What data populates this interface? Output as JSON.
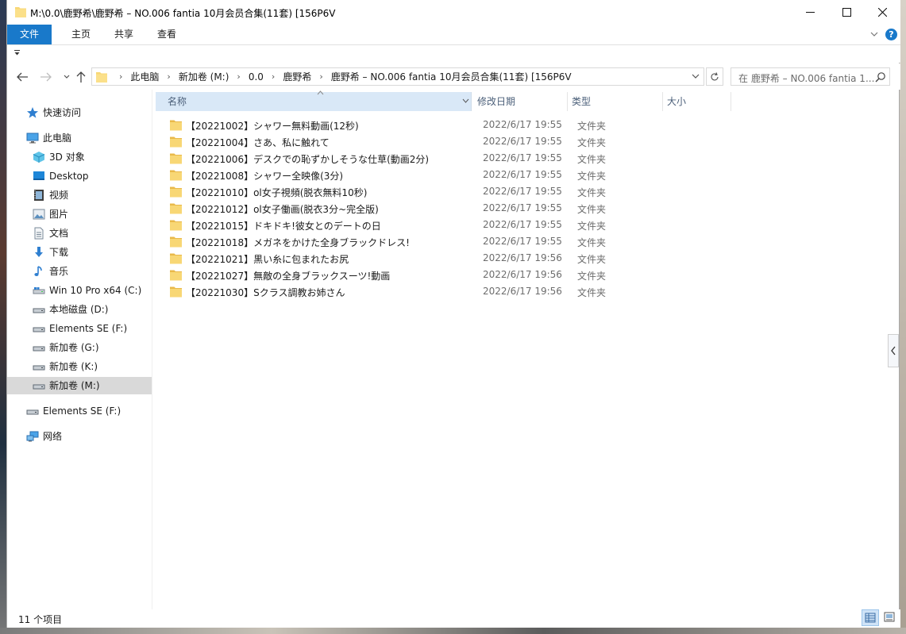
{
  "window": {
    "title": "M:\\0.0\\鹿野希\\鹿野希 – NO.006 fantia 10月会员合集(11套) [156P6V",
    "controls": {
      "minimize": "—",
      "maximize": "☐",
      "close": "✕"
    }
  },
  "ribbon": {
    "tabs": [
      "文件",
      "主页",
      "共享",
      "查看"
    ],
    "help": "?"
  },
  "address": {
    "crumbs": [
      "此电脑",
      "新加卷 (M:)",
      "0.0",
      "鹿野希",
      "鹿野希 – NO.006 fantia 10月会员合集(11套) [156P6V"
    ],
    "search_placeholder": "在 鹿野希 – NO.006 fantia 1..."
  },
  "nav": {
    "quick_access": "快速访问",
    "this_pc": "此电脑",
    "items": [
      {
        "label": "3D 对象",
        "icon": "3d-objects-icon"
      },
      {
        "label": "Desktop",
        "icon": "desktop-icon"
      },
      {
        "label": "视频",
        "icon": "video-icon"
      },
      {
        "label": "图片",
        "icon": "pictures-icon"
      },
      {
        "label": "文档",
        "icon": "documents-icon"
      },
      {
        "label": "下载",
        "icon": "download-icon"
      },
      {
        "label": "音乐",
        "icon": "music-icon"
      },
      {
        "label": "Win 10 Pro x64 (C:)",
        "icon": "system-drive-icon"
      },
      {
        "label": "本地磁盘 (D:)",
        "icon": "drive-icon"
      },
      {
        "label": "Elements SE (F:)",
        "icon": "drive-icon"
      },
      {
        "label": "新加卷 (G:)",
        "icon": "drive-icon"
      },
      {
        "label": "新加卷 (K:)",
        "icon": "drive-icon"
      },
      {
        "label": "新加卷 (M:)",
        "icon": "drive-icon",
        "selected": true
      }
    ],
    "external": "Elements SE (F:)",
    "network": "网络"
  },
  "columns": {
    "name": "名称",
    "date": "修改日期",
    "type": "类型",
    "size": "大小"
  },
  "files": [
    {
      "name": "【20221002】シャワー無料動画(12秒)",
      "date": "2022/6/17 19:55",
      "type": "文件夹"
    },
    {
      "name": "【20221004】さあ、私に触れて",
      "date": "2022/6/17 19:55",
      "type": "文件夹"
    },
    {
      "name": "【20221006】デスクでの恥ずかしそうな仕草(動画2分)",
      "date": "2022/6/17 19:55",
      "type": "文件夹"
    },
    {
      "name": "【20221008】シャワー全映像(3分)",
      "date": "2022/6/17 19:55",
      "type": "文件夹"
    },
    {
      "name": "【20221010】ol女子視頻(脱衣無料10秒)",
      "date": "2022/6/17 19:55",
      "type": "文件夹"
    },
    {
      "name": "【20221012】ol女子働画(脱衣3分~完全版)",
      "date": "2022/6/17 19:55",
      "type": "文件夹"
    },
    {
      "name": "【20221015】ドキドキ!彼女とのデートの日",
      "date": "2022/6/17 19:55",
      "type": "文件夹"
    },
    {
      "name": "【20221018】メガネをかけた全身ブラックドレス!",
      "date": "2022/6/17 19:55",
      "type": "文件夹"
    },
    {
      "name": "【20221021】黒い糸に包まれたお尻",
      "date": "2022/6/17 19:56",
      "type": "文件夹"
    },
    {
      "name": "【20221027】無敵の全身ブラックスーツ!動画",
      "date": "2022/6/17 19:56",
      "type": "文件夹"
    },
    {
      "name": "【20221030】Sクラス調教お姉さん",
      "date": "2022/6/17 19:56",
      "type": "文件夹"
    }
  ],
  "status": {
    "count": "11 个项目"
  },
  "colors": {
    "accent": "#1979ca",
    "folder": "#f8d775",
    "selection": "#d9e8f7"
  }
}
